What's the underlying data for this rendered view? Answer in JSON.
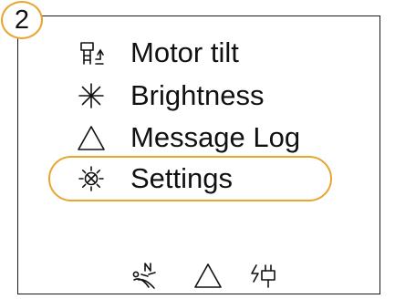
{
  "step_badge": "2",
  "menu": {
    "items": [
      {
        "label": "Motor tilt",
        "icon": "motor-tilt-icon",
        "selected": false
      },
      {
        "label": "Brightness",
        "icon": "brightness-asterisk-icon",
        "selected": false
      },
      {
        "label": "Message Log",
        "icon": "warning-triangle-icon",
        "selected": false
      },
      {
        "label": "Settings",
        "icon": "settings-sun-icon",
        "selected": true
      }
    ]
  },
  "status_bar": {
    "icons": [
      "seat-north-icon",
      "warning-triangle-icon",
      "charging-plug-icon"
    ]
  },
  "colors": {
    "accent": "#e8a530",
    "ink": "#111111",
    "frame": "#1a1a1a"
  }
}
